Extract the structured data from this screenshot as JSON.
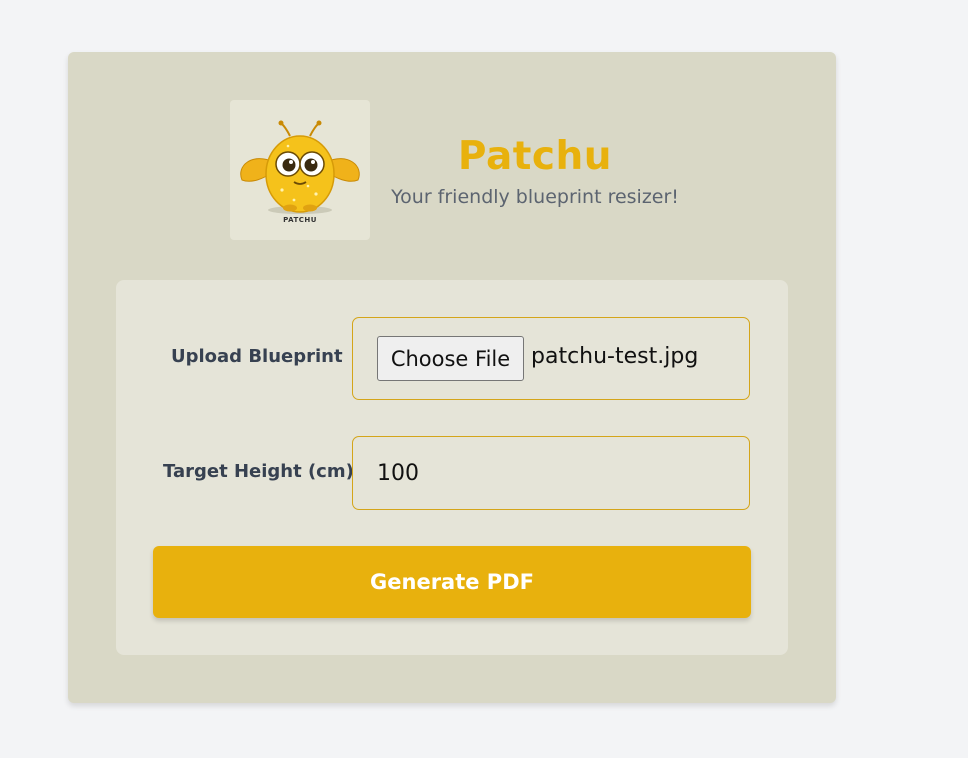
{
  "header": {
    "logo_caption": "PATCHU",
    "title": "Patchu",
    "subtitle": "Your friendly blueprint resizer!"
  },
  "form": {
    "upload_label": "Upload Blueprint",
    "choose_file_label": "Choose File",
    "selected_file": "patchu-test.jpg",
    "height_label": "Target Height (cm)",
    "height_value": "100",
    "generate_label": "Generate PDF"
  },
  "colors": {
    "accent": "#e8b10d",
    "card_bg": "#d9d8c6",
    "panel_bg": "#e5e4d8",
    "page_bg": "#f3f4f6",
    "subtitle": "#5c6470"
  },
  "icons": {
    "logo": "patchu-mascot-icon"
  }
}
